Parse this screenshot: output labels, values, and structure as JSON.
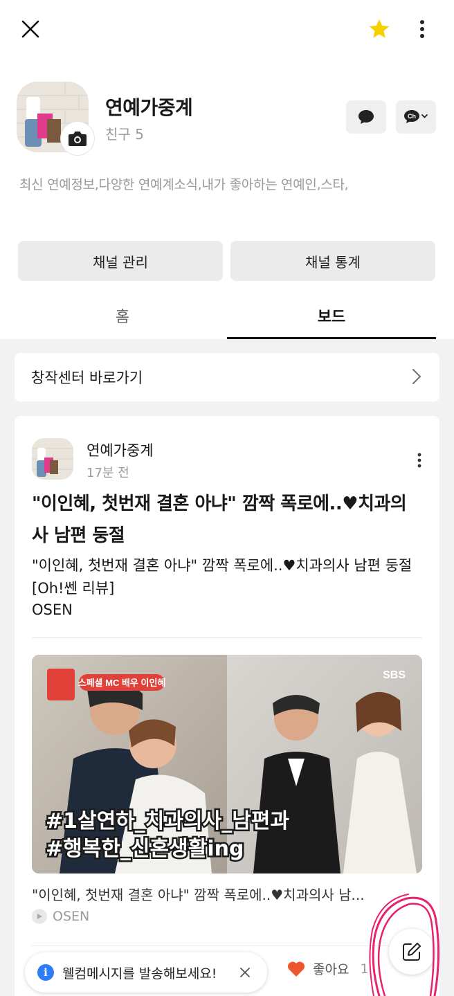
{
  "header": {
    "icons": [
      "close-icon",
      "star-icon",
      "more-vertical-icon"
    ],
    "star_color": "#f7d000"
  },
  "profile": {
    "name": "연예가중계",
    "friends": "친구 5",
    "description": "최신 연예정보,다양한 연예계소식,내가 좋아하는 연예인,스타,"
  },
  "actions": {
    "manage_label": "채널 관리",
    "stats_label": "채널 통계"
  },
  "tabs": [
    {
      "label": "홈",
      "active": false
    },
    {
      "label": "보드",
      "active": true
    }
  ],
  "creator_center": {
    "label": "창작센터 바로가기"
  },
  "post": {
    "author": "연예가중계",
    "time": "17분 전",
    "title": "\"이인혜, 첫번재 결혼 아냐\" 깜짝 폭로에..♥치과의사 남편 둥절",
    "body": "\"이인혜, 첫번재 결혼 아냐\" 깜짝 폭로에..♥치과의사 남편 둥절 [Oh!쎈 리뷰]",
    "source": "OSEN",
    "thumbnail": {
      "badge_text": "스페셜 MC  배우 이인혜",
      "network": "SBS",
      "caption_line1": "#1살연하_치과의사_남편과",
      "caption_line2": "#행복한_신혼생활ing"
    },
    "link_title": "\"이인혜, 첫번재 결혼 아냐\" 깜짝 폭로에..♥치과의사 남...",
    "link_source": "OSEN"
  },
  "footer": {
    "toast_text": "웰컴메시지를 발송해보세요!",
    "like_label": "좋아요",
    "like_count": "1",
    "like_color": "#f0562e",
    "annotation_color": "#e8226e"
  }
}
